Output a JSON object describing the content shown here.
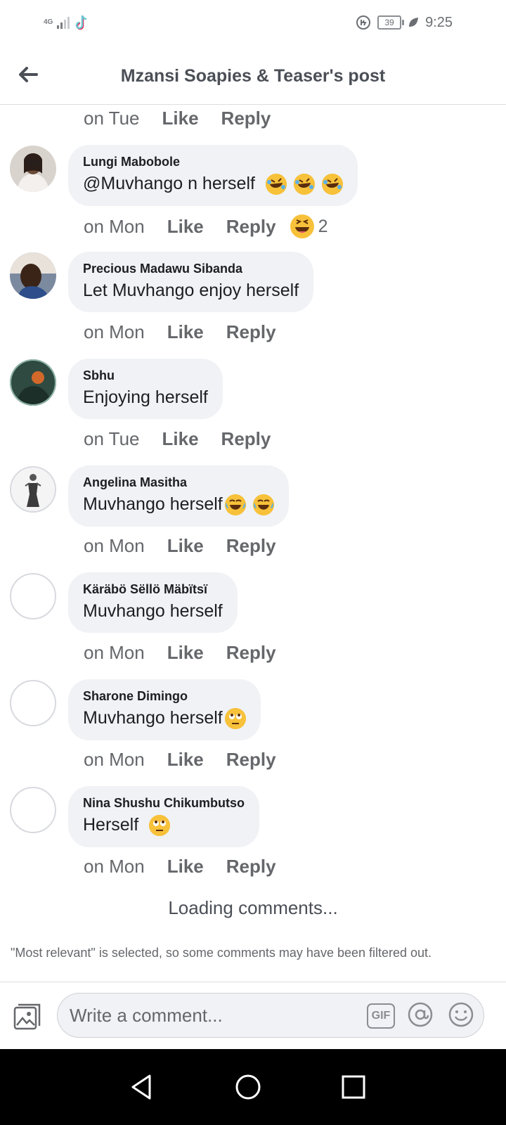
{
  "status_bar": {
    "network": "4G",
    "battery": "39",
    "time": "9:25"
  },
  "header": {
    "title": "Mzansi Soapies & Teaser's post"
  },
  "top_meta": {
    "time": "on Tue",
    "like": "Like",
    "reply": "Reply"
  },
  "comments": [
    {
      "author": "Lungi Mabobole",
      "text": "@Muvhango n herself",
      "emojis": [
        "rofl-emoji",
        "rofl-emoji",
        "rofl-emoji"
      ],
      "time": "on Mon",
      "like": "Like",
      "reply": "Reply",
      "reaction_count": "2"
    },
    {
      "author": "Precious Madawu Sibanda",
      "text": "Let Muvhango enjoy herself",
      "time": "on Mon",
      "like": "Like",
      "reply": "Reply"
    },
    {
      "author": "Sbhu",
      "text": "Enjoying herself",
      "time": "on Tue",
      "like": "Like",
      "reply": "Reply"
    },
    {
      "author": "Angelina Masitha",
      "text": "Muvhango herself",
      "emojis": [
        "tears-of-joy-emoji",
        "tears-of-joy-emoji"
      ],
      "time": "on Mon",
      "like": "Like",
      "reply": "Reply"
    },
    {
      "author": "Käräbö Sëllö Mäbïtsï",
      "text": "Muvhango herself",
      "time": "on Mon",
      "like": "Like",
      "reply": "Reply"
    },
    {
      "author": "Sharone Dimingo",
      "text": "Muvhango herself",
      "emojis": [
        "eye-roll-emoji"
      ],
      "time": "on Mon",
      "like": "Like",
      "reply": "Reply"
    },
    {
      "author": "Nina Shushu Chikumbutso",
      "text": "Herself ",
      "emojis": [
        "eye-roll-emoji"
      ],
      "time": "on Mon",
      "like": "Like",
      "reply": "Reply"
    }
  ],
  "loading_text": "Loading comments...",
  "filter_notice": "\"Most relevant\" is selected, so some comments may have been filtered out.",
  "composer": {
    "placeholder": "Write a comment...",
    "gif_label": "GIF"
  },
  "colors": {
    "bubble": "#f0f2f5",
    "meta_text": "#65676b",
    "emoji_yellow": "#f7c13a"
  }
}
